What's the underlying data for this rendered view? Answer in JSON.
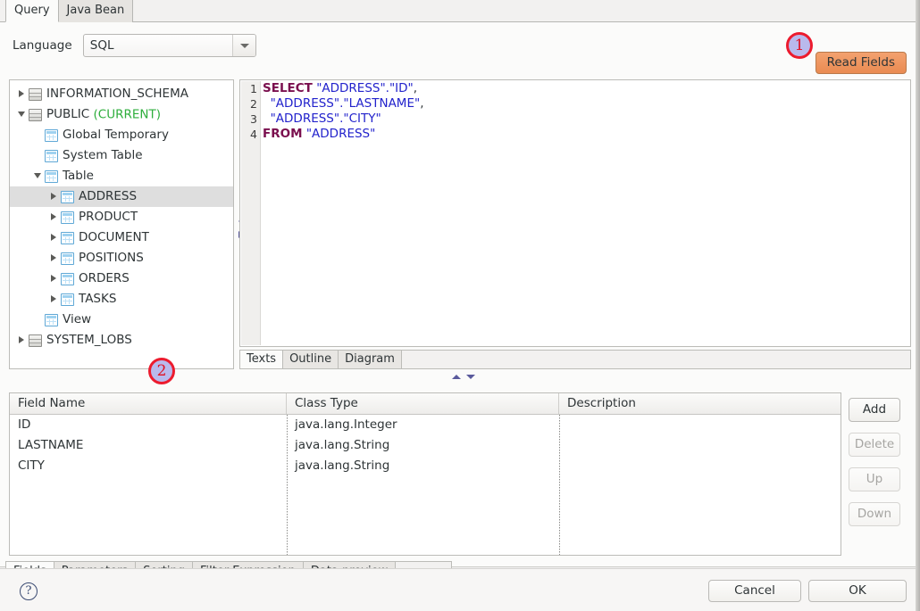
{
  "window": {
    "tabs": [
      {
        "label": "Query",
        "active": true
      },
      {
        "label": "Java Bean",
        "active": false
      }
    ]
  },
  "language_row": {
    "label": "Language",
    "value": "SQL",
    "options": [
      "SQL"
    ],
    "caret_icon": "chevron-down-icon"
  },
  "read_fields_button": {
    "label": "Read Fields",
    "color": "#e98b52"
  },
  "annotations": [
    {
      "id": "1",
      "text": "1",
      "fill": "#b9b9ec",
      "border": "#ec1b2e"
    },
    {
      "id": "2",
      "text": "2",
      "fill": "#b9b9ec",
      "border": "#ec1b2e"
    }
  ],
  "tree": {
    "nodes": [
      {
        "label": "INFORMATION_SCHEMA",
        "indent": 0,
        "twist": "closed",
        "icon": "database-icon",
        "selected": false,
        "suffix": ""
      },
      {
        "label": "PUBLIC",
        "indent": 0,
        "twist": "open",
        "icon": "database-icon",
        "selected": false,
        "suffix": "(CURRENT)"
      },
      {
        "label": "Global Temporary",
        "indent": 1,
        "twist": "none",
        "icon": "table-icon",
        "selected": false,
        "suffix": ""
      },
      {
        "label": "System Table",
        "indent": 1,
        "twist": "none",
        "icon": "table-icon",
        "selected": false,
        "suffix": ""
      },
      {
        "label": "Table",
        "indent": 1,
        "twist": "open",
        "icon": "table-icon",
        "selected": false,
        "suffix": ""
      },
      {
        "label": "ADDRESS",
        "indent": 2,
        "twist": "closed",
        "icon": "table-icon",
        "selected": true,
        "suffix": ""
      },
      {
        "label": "PRODUCT",
        "indent": 2,
        "twist": "closed",
        "icon": "table-icon",
        "selected": false,
        "suffix": ""
      },
      {
        "label": "DOCUMENT",
        "indent": 2,
        "twist": "closed",
        "icon": "table-icon",
        "selected": false,
        "suffix": ""
      },
      {
        "label": "POSITIONS",
        "indent": 2,
        "twist": "closed",
        "icon": "table-icon",
        "selected": false,
        "suffix": ""
      },
      {
        "label": "ORDERS",
        "indent": 2,
        "twist": "closed",
        "icon": "table-icon",
        "selected": false,
        "suffix": ""
      },
      {
        "label": "TASKS",
        "indent": 2,
        "twist": "closed",
        "icon": "table-icon",
        "selected": false,
        "suffix": ""
      },
      {
        "label": "View",
        "indent": 1,
        "twist": "none",
        "icon": "table-icon",
        "selected": false,
        "suffix": ""
      },
      {
        "label": "SYSTEM_LOBS",
        "indent": 0,
        "twist": "closed",
        "icon": "database-icon",
        "selected": false,
        "suffix": ""
      }
    ]
  },
  "editor": {
    "line_numbers": [
      "1",
      "2",
      "3",
      "4"
    ],
    "lines": [
      [
        {
          "t": "SELECT",
          "k": "kw"
        },
        {
          "t": " ",
          "k": "pl"
        },
        {
          "t": "\"ADDRESS\".\"ID\"",
          "k": "str"
        },
        {
          "t": ",",
          "k": "pl"
        }
      ],
      [
        {
          "t": "  ",
          "k": "pl"
        },
        {
          "t": "\"ADDRESS\".\"LASTNAME\"",
          "k": "str"
        },
        {
          "t": ",",
          "k": "pl"
        }
      ],
      [
        {
          "t": "  ",
          "k": "pl"
        },
        {
          "t": "\"ADDRESS\".\"CITY\"",
          "k": "str"
        }
      ],
      [
        {
          "t": "FROM",
          "k": "kw"
        },
        {
          "t": " ",
          "k": "pl"
        },
        {
          "t": "\"ADDRESS\"",
          "k": "str"
        }
      ]
    ],
    "plain_text": "SELECT \"ADDRESS\".\"ID\",\n  \"ADDRESS\".\"LASTNAME\",\n  \"ADDRESS\".\"CITY\"\nFROM \"ADDRESS\"",
    "tabs": [
      {
        "label": "Texts",
        "active": true
      },
      {
        "label": "Outline",
        "active": false
      },
      {
        "label": "Diagram",
        "active": false
      }
    ]
  },
  "fields_table": {
    "columns": [
      "Field Name",
      "Class Type",
      "Description"
    ],
    "rows": [
      {
        "field_name": "ID",
        "class_type": "java.lang.Integer",
        "description": ""
      },
      {
        "field_name": "LASTNAME",
        "class_type": "java.lang.String",
        "description": ""
      },
      {
        "field_name": "CITY",
        "class_type": "java.lang.String",
        "description": ""
      }
    ]
  },
  "side_buttons": [
    {
      "label": "Add",
      "enabled": true
    },
    {
      "label": "Delete",
      "enabled": false
    },
    {
      "label": "Up",
      "enabled": false
    },
    {
      "label": "Down",
      "enabled": false
    }
  ],
  "bottom_tabs": [
    {
      "label": "Fields",
      "active": true
    },
    {
      "label": "Parameters",
      "active": false
    },
    {
      "label": "Sorting",
      "active": false
    },
    {
      "label": "Filter Expression",
      "active": false
    },
    {
      "label": "Data preview",
      "active": false
    }
  ],
  "footer": {
    "help_icon": "help-question-icon",
    "help_glyph": "?",
    "cancel_label": "Cancel",
    "ok_label": "OK"
  }
}
